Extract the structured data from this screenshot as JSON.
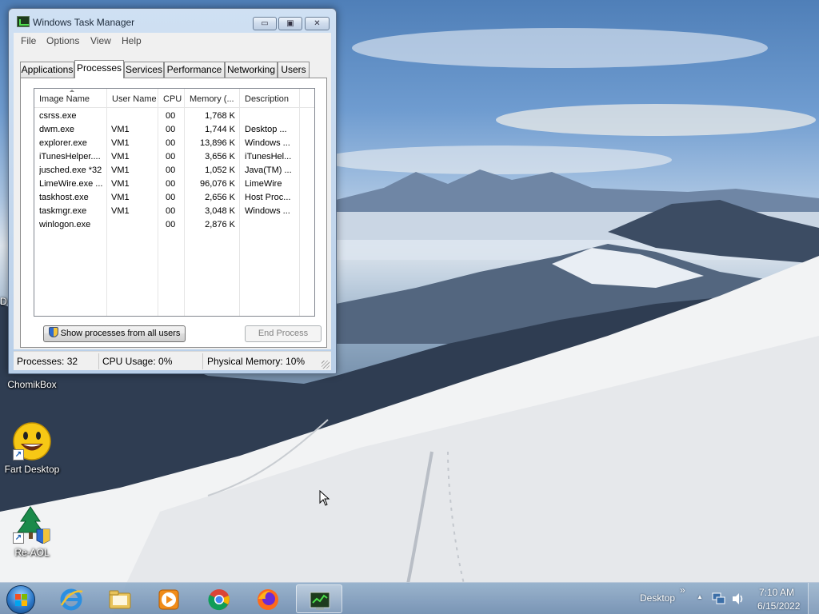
{
  "window": {
    "title": "Windows Task Manager",
    "caption_min": "▭",
    "caption_max": "▣",
    "caption_close": "✕"
  },
  "menu": [
    "File",
    "Options",
    "View",
    "Help"
  ],
  "tabs": [
    {
      "label": "Applications"
    },
    {
      "label": "Processes",
      "active": true
    },
    {
      "label": "Services"
    },
    {
      "label": "Performance"
    },
    {
      "label": "Networking"
    },
    {
      "label": "Users"
    }
  ],
  "table": {
    "columns": [
      "Image Name",
      "User Name",
      "CPU",
      "Memory (...",
      "Description"
    ],
    "rows": [
      [
        "csrss.exe",
        "",
        "00",
        "1,768 K",
        ""
      ],
      [
        "dwm.exe",
        "VM1",
        "00",
        "1,744 K",
        "Desktop ..."
      ],
      [
        "explorer.exe",
        "VM1",
        "00",
        "13,896 K",
        "Windows ..."
      ],
      [
        "iTunesHelper....",
        "VM1",
        "00",
        "3,656 K",
        "iTunesHel..."
      ],
      [
        "jusched.exe *32",
        "VM1",
        "00",
        "1,052 K",
        "Java(TM) ..."
      ],
      [
        "LimeWire.exe ...",
        "VM1",
        "00",
        "96,076 K",
        "LimeWire"
      ],
      [
        "taskhost.exe",
        "VM1",
        "00",
        "2,656 K",
        "Host Proc..."
      ],
      [
        "taskmgr.exe",
        "VM1",
        "00",
        "3,048 K",
        "Windows ..."
      ],
      [
        "winlogon.exe",
        "",
        "00",
        "2,876 K",
        ""
      ]
    ]
  },
  "buttons": {
    "show_all": "Show processes from all users",
    "end_process": "End Process"
  },
  "status": {
    "processes": "Processes: 32",
    "cpu": "CPU Usage: 0%",
    "memory": "Physical Memory: 10%"
  },
  "desktop_icons": [
    {
      "label": "ChomikBox"
    },
    {
      "label": "Fart Desktop"
    },
    {
      "label": "Re-AOL"
    }
  ],
  "desktop_edge_letter": "D",
  "taskbar": {
    "pinned": [
      "internet-explorer-icon",
      "windows-explorer-icon",
      "media-player-icon",
      "chrome-icon",
      "firefox-icon",
      "task-manager-icon"
    ],
    "desktop_toolbar": "Desktop",
    "toolbar_chevron": "»",
    "tray_arrow": "▲",
    "time": "7:10 AM",
    "date": "6/15/2022"
  }
}
